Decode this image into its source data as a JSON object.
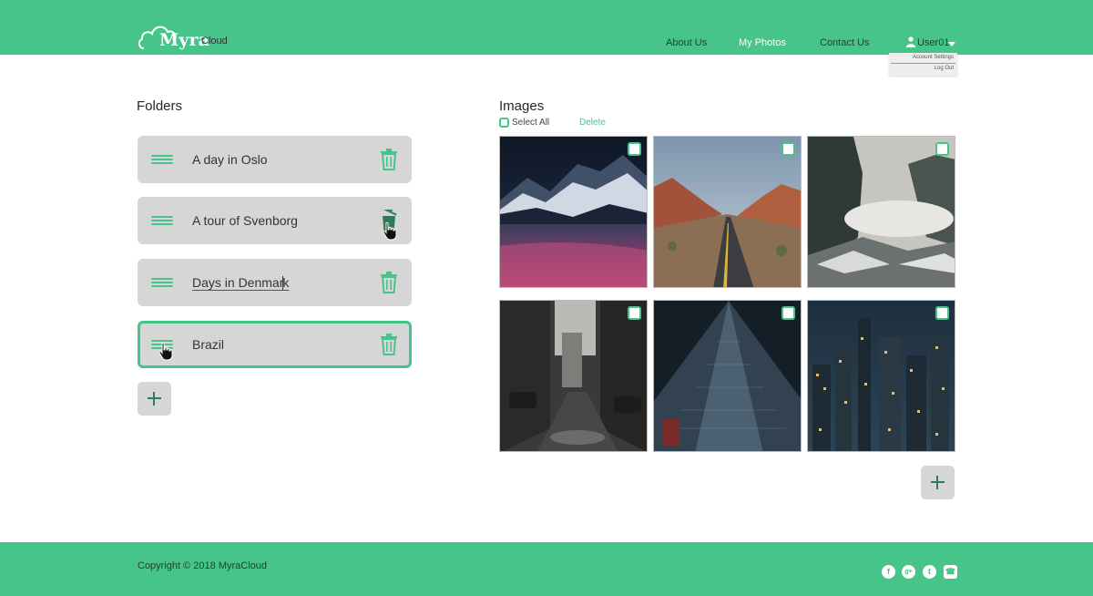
{
  "brand": {
    "name_main": "Myra",
    "name_sub": "Cloud"
  },
  "nav": {
    "about": "About Us",
    "photos": "My Photos",
    "contact": "Contact Us"
  },
  "user": {
    "name": "User01",
    "menu": [
      "Account Settings",
      "Log Out"
    ]
  },
  "folders": {
    "title": "Folders",
    "items": [
      {
        "name": "A day in Oslo"
      },
      {
        "name": "A tour of Svenborg"
      },
      {
        "name_before_caret": "Days in Denmar",
        "name_after_caret": "k"
      },
      {
        "name": "Brazil",
        "selected": true
      }
    ]
  },
  "images": {
    "title": "Images",
    "select_all": "Select All",
    "delete": "Delete",
    "items": [
      {
        "scene": "snowy mountains at night"
      },
      {
        "scene": "desert road with red rocks"
      },
      {
        "scene": "misty granite cliffs"
      },
      {
        "scene": "rainy city street"
      },
      {
        "scene": "skyscraper from below"
      },
      {
        "scene": "city lights at dusk"
      }
    ]
  },
  "footer": {
    "copyright": "Copyright © 2018 MyraCloud"
  },
  "colors": {
    "accent": "#47c48a",
    "panel": "#d6d6d6",
    "dark_accent": "#2f7a57"
  }
}
